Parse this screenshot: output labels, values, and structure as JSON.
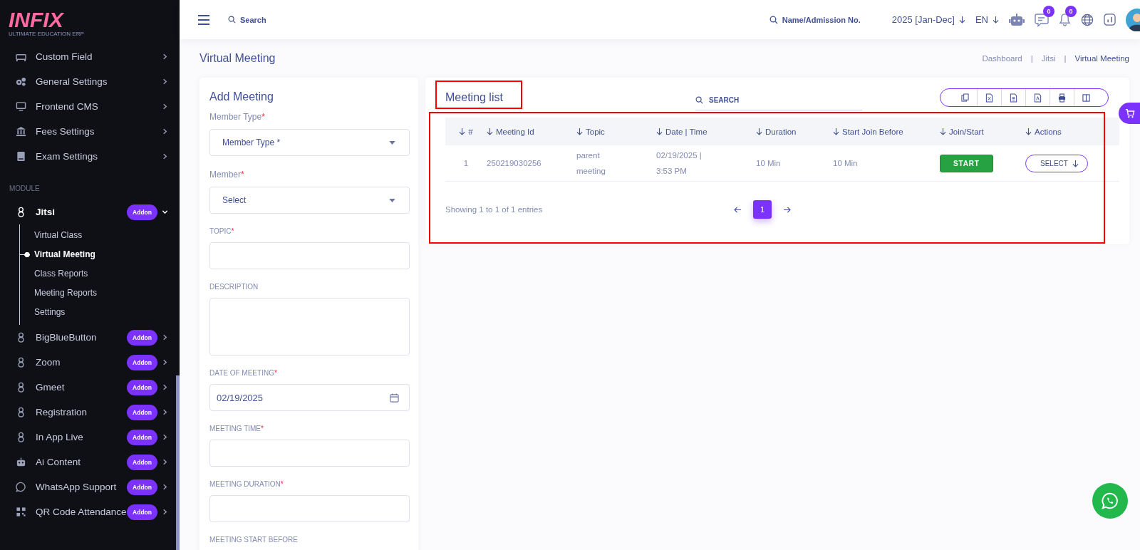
{
  "logo": {
    "name": "INFIX",
    "tagline": "ULTIMATE EDUCATION ERP"
  },
  "sidebar": {
    "items": [
      {
        "label": "Custom Field",
        "expanded": false
      },
      {
        "label": "General Settings",
        "expanded": false
      },
      {
        "label": "Frontend CMS",
        "expanded": false
      },
      {
        "label": "Fees Settings",
        "expanded": false
      },
      {
        "label": "Exam Settings",
        "expanded": false
      }
    ],
    "section": "MODULE",
    "modules": [
      {
        "label": "Jitsi",
        "badge": "Addon",
        "expanded": true,
        "children": [
          {
            "label": "Virtual Class",
            "selected": false
          },
          {
            "label": "Virtual Meeting",
            "selected": true
          },
          {
            "label": "Class Reports",
            "selected": false
          },
          {
            "label": "Meeting Reports",
            "selected": false
          },
          {
            "label": "Settings",
            "selected": false
          }
        ]
      },
      {
        "label": "BigBlueButton",
        "badge": "Addon",
        "expanded": false
      },
      {
        "label": "Zoom",
        "badge": "Addon",
        "expanded": false
      },
      {
        "label": "Gmeet",
        "badge": "Addon",
        "expanded": false
      },
      {
        "label": "Registration",
        "badge": "Addon",
        "expanded": false
      },
      {
        "label": "In App Live",
        "badge": "Addon",
        "expanded": false
      },
      {
        "label": "Ai Content",
        "badge": "Addon",
        "expanded": false
      },
      {
        "label": "WhatsApp Support",
        "badge": "Addon",
        "expanded": false
      },
      {
        "label": "QR Code Attendance",
        "badge": "Addon",
        "expanded": false
      }
    ]
  },
  "header": {
    "search_placeholder": "Search",
    "student_search_placeholder": "Name/Admission No.",
    "session": "2025 [Jan-Dec]",
    "language": "EN",
    "chat_count": "0",
    "notification_count": "0"
  },
  "page": {
    "title": "Virtual Meeting",
    "breadcrumb": [
      "Dashboard",
      "Jitsi",
      "Virtual Meeting"
    ],
    "breadcrumb_separator": "|"
  },
  "form": {
    "title": "Add Meeting",
    "required_mark": "*",
    "fields": [
      {
        "kind": "select",
        "label": "Member Type",
        "required": true,
        "value": "Member Type *"
      },
      {
        "kind": "select",
        "label": "Member",
        "required": true,
        "value": "Select"
      },
      {
        "kind": "text",
        "label": "TOPIC",
        "required": true
      },
      {
        "kind": "textarea",
        "label": "DESCRIPTION",
        "required": false
      },
      {
        "kind": "date",
        "label": "DATE OF MEETING",
        "required": true,
        "value": "02/19/2025"
      },
      {
        "kind": "text",
        "label": "MEETING TIME",
        "required": true
      },
      {
        "kind": "text",
        "label": "MEETING DURATION",
        "required": true
      },
      {
        "kind": "label",
        "label": "MEETING START BEFORE",
        "required": false
      }
    ]
  },
  "meeting_list": {
    "title": "Meeting list",
    "search_placeholder": "SEARCH",
    "table": {
      "columns": [
        "#",
        "Meeting Id",
        "Topic",
        "Date | Time",
        "Duration",
        "Start Join Before",
        "Join/Start",
        "Actions"
      ],
      "rows": [
        {
          "cells": [
            "1",
            "250219030256",
            "parent meeting",
            "02/19/2025 | 3:53 PM",
            "10 Min",
            "10 Min"
          ],
          "join": "START",
          "action": "SELECT"
        }
      ]
    },
    "info": "Showing 1 to 1 of 1 entries",
    "pages": [
      {
        "label": "1",
        "selected": true
      }
    ]
  }
}
